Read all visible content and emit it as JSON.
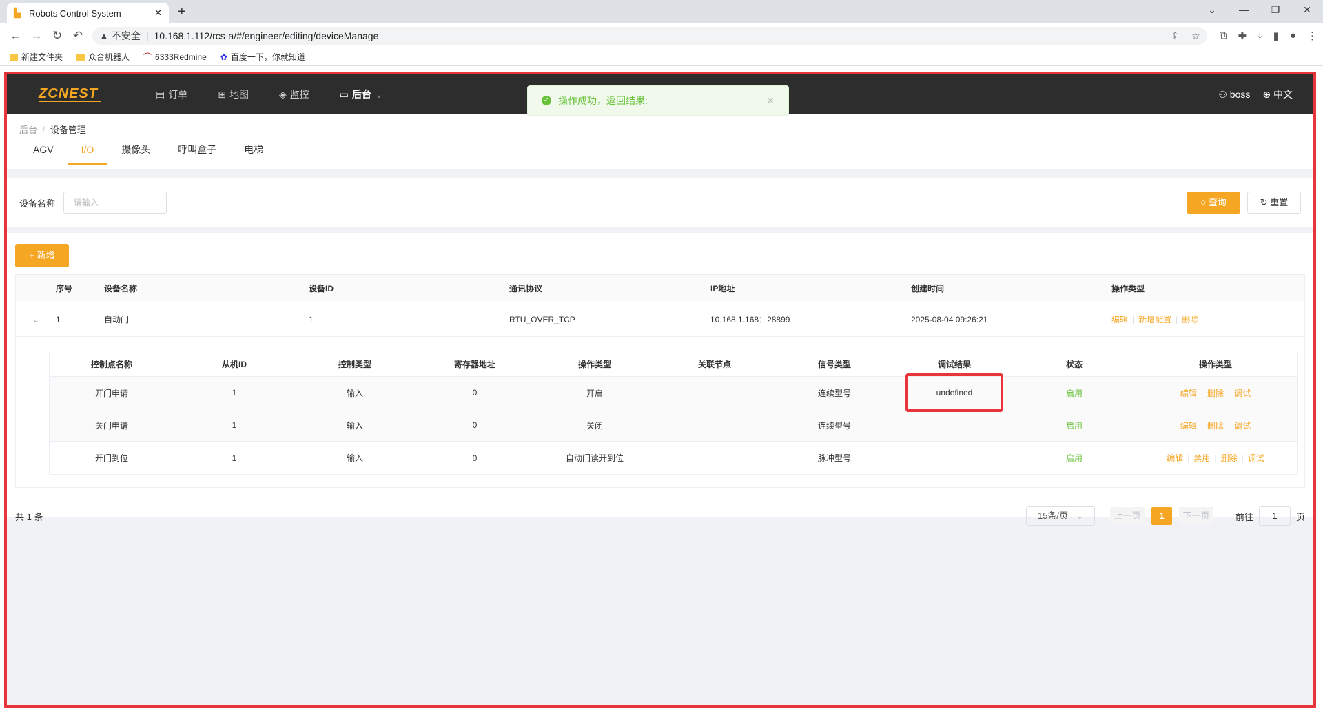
{
  "browser": {
    "tab_title": "Robots Control System",
    "insecure": "不安全",
    "url": "10.168.1.112/rcs-a/#/engineer/editing/deviceManage",
    "bookmarks": [
      "新建文件夹",
      "众合机器人",
      "6333Redmine",
      "百度一下，你就知道"
    ]
  },
  "nav": {
    "logo": "ZCNEST",
    "menu": [
      "订单",
      "地图",
      "监控",
      "后台"
    ],
    "user": "boss",
    "lang": "中文"
  },
  "toast": {
    "message": "操作成功，返回结果:"
  },
  "breadcrumb": {
    "root": "后台",
    "current": "设备管理"
  },
  "tabs": [
    "AGV",
    "I/O",
    "摄像头",
    "呼叫盒子",
    "电梯"
  ],
  "filter": {
    "label": "设备名称",
    "placeholder": "请输入",
    "query": "查询",
    "reset": "重置"
  },
  "add_button": "新增",
  "table": {
    "headers": [
      "序号",
      "设备名称",
      "设备ID",
      "通讯协议",
      "IP地址",
      "创建时间",
      "操作类型"
    ],
    "row": {
      "no": "1",
      "name": "自动门",
      "id": "1",
      "protocol": "RTU_OVER_TCP",
      "ip": "10.168.1.168：28899",
      "created": "2025-08-04 09:26:21",
      "ops": [
        "编辑",
        "新增配置",
        "删除"
      ]
    }
  },
  "subtable": {
    "headers": [
      "控制点名称",
      "从机ID",
      "控制类型",
      "寄存器地址",
      "操作类型",
      "关联节点",
      "信号类型",
      "调试结果",
      "状态",
      "操作类型"
    ],
    "rows": [
      {
        "name": "开门申请",
        "slave": "1",
        "ctrl": "输入",
        "reg": "0",
        "op": "开启",
        "node": "",
        "signal": "连续型号",
        "result": "undefined",
        "status": "启用",
        "ops": [
          "编辑",
          "删除",
          "调试"
        ]
      },
      {
        "name": "关门申请",
        "slave": "1",
        "ctrl": "输入",
        "reg": "0",
        "op": "关闭",
        "node": "",
        "signal": "连续型号",
        "result": "",
        "status": "启用",
        "ops": [
          "编辑",
          "删除",
          "调试"
        ]
      },
      {
        "name": "开门到位",
        "slave": "1",
        "ctrl": "输入",
        "reg": "0",
        "op": "自动门读开到位",
        "node": "",
        "signal": "脉冲型号",
        "result": "",
        "status": "启用",
        "ops": [
          "编辑",
          "禁用",
          "删除",
          "调试"
        ]
      }
    ]
  },
  "pagination": {
    "total": "共 1 条",
    "size": "15条/页",
    "prev": "上一页",
    "page": "1",
    "next": "下一页",
    "goto": "前往",
    "goto_val": "1",
    "unit": "页"
  }
}
